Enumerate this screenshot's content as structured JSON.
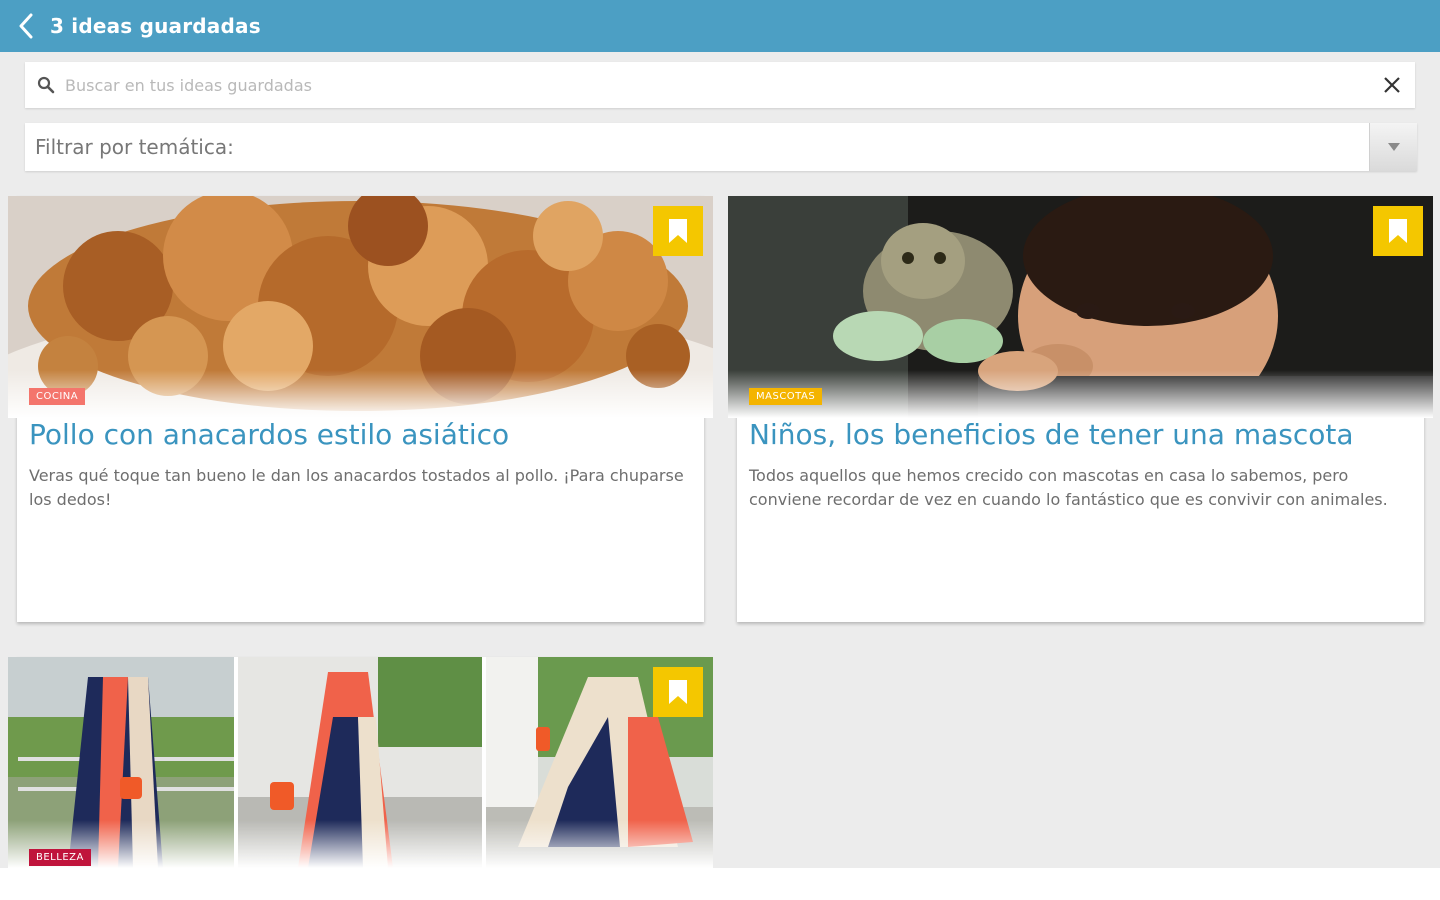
{
  "header": {
    "title": "3 ideas guardadas"
  },
  "search": {
    "placeholder": "Buscar en tus ideas guardadas",
    "value": ""
  },
  "filter": {
    "label": "Filtrar por temática:"
  },
  "colors": {
    "topbar": "#4c9fc4",
    "title": "#3a94bf",
    "bookmark": "#f4c700"
  },
  "cards": [
    {
      "category": "COCINA",
      "category_color": "#f4756c",
      "title": "Pollo con anacardos estilo asiático",
      "description": "Veras qué toque tan bueno le dan los anacardos tostados al pollo. ¡Para chuparse los dedos!"
    },
    {
      "category": "MASCOTAS",
      "category_color": "#f4b400",
      "title": "Niños, los beneficios de tener una mascota",
      "description": "Todos aquellos que hemos crecido con mascotas en casa lo sabemos, pero conviene recordar de vez en cuando lo fantástico que es convivir con animales."
    },
    {
      "category": "BELLEZA",
      "category_color": "#c0143c",
      "title": "",
      "description": ""
    }
  ]
}
